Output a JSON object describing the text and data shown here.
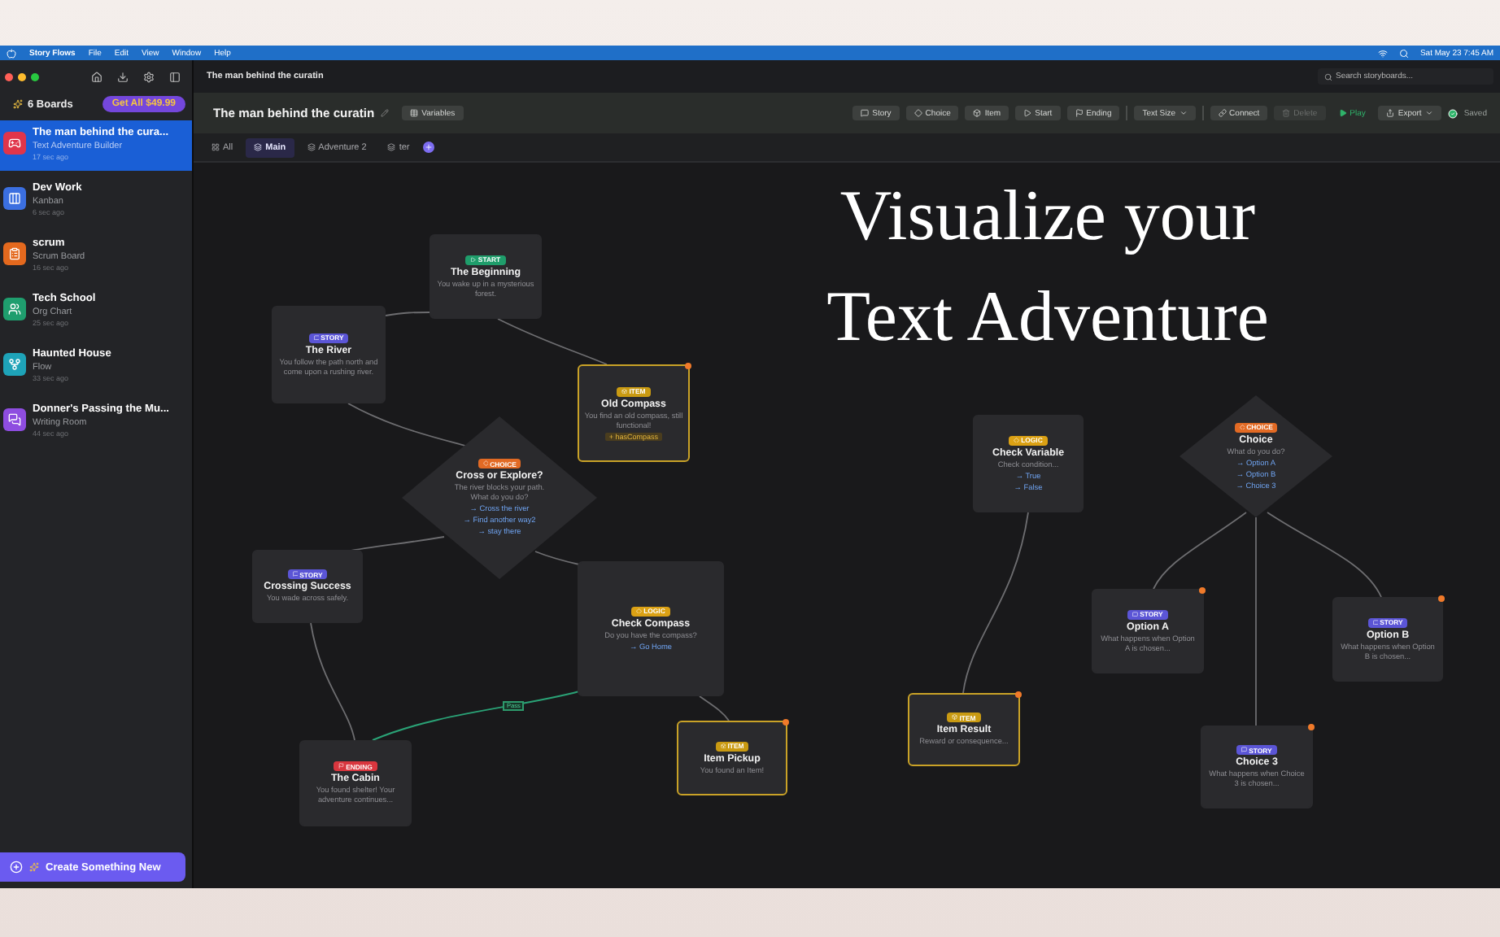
{
  "menu_bar": {
    "app": "Story Flows",
    "menus": [
      "File",
      "Edit",
      "View",
      "Window",
      "Help"
    ],
    "clock": "Sat May 23  7:45 AM"
  },
  "window": {
    "title": "The man behind the curatin"
  },
  "sidebar": {
    "boards_count": "6 Boards",
    "promo": "Get All $49.99",
    "items": [
      {
        "title": "The man behind the cura...",
        "subtitle": "Text Adventure Builder",
        "time": "17 sec ago",
        "color": "#e0354a",
        "kind": "game",
        "selected": true
      },
      {
        "title": "Dev Work",
        "subtitle": "Kanban",
        "time": "6 sec ago",
        "color": "#3b6fe0",
        "kind": "kanban",
        "selected": false
      },
      {
        "title": "scrum",
        "subtitle": "Scrum Board",
        "time": "16 sec ago",
        "color": "#e4691e",
        "kind": "scrum",
        "selected": false
      },
      {
        "title": "Tech School",
        "subtitle": "Org Chart",
        "time": "25 sec ago",
        "color": "#1f9e6e",
        "kind": "org",
        "selected": false
      },
      {
        "title": "Haunted House",
        "subtitle": "Flow",
        "time": "33 sec ago",
        "color": "#1ea3b8",
        "kind": "flow",
        "selected": false
      },
      {
        "title": "Donner's Passing the Mu...",
        "subtitle": "Writing Room",
        "time": "44 sec ago",
        "color": "#8e4de0",
        "kind": "writing",
        "selected": false
      }
    ],
    "create_button": "Create Something New"
  },
  "search": {
    "placeholder": "Search storyboards..."
  },
  "toolbar": {
    "title": "The man behind the curatin",
    "variables": "Variables",
    "buttons": [
      {
        "label": "Story",
        "kind": "story",
        "disabled": false
      },
      {
        "label": "Choice",
        "kind": "choice",
        "disabled": false
      },
      {
        "label": "Item",
        "kind": "item",
        "disabled": false
      },
      {
        "label": "Start",
        "kind": "start",
        "disabled": false
      },
      {
        "label": "Ending",
        "kind": "ending",
        "disabled": false
      },
      {
        "label": "Text Size",
        "kind": "textsize",
        "disabled": false
      },
      {
        "label": "Connect",
        "kind": "connect",
        "disabled": false
      },
      {
        "label": "Delete",
        "kind": "delete",
        "disabled": true
      }
    ],
    "play": "Play",
    "export": "Export",
    "status": "Saved"
  },
  "tabs": [
    {
      "label": "All",
      "selected": false
    },
    {
      "label": "Main",
      "selected": true
    },
    {
      "label": "Adventure 2",
      "selected": false
    },
    {
      "label": "ter",
      "selected": false
    }
  ],
  "headline": [
    "Visualize your",
    "Text Adventure"
  ],
  "nodes": [
    {
      "kind": "start",
      "badge": "START",
      "title": "The Beginning",
      "text": "You wake up in a mysterious forest.",
      "flagged": false
    },
    {
      "kind": "story",
      "badge": "STORY",
      "title": "The River",
      "text": "You follow the path north and come upon a rushing river.",
      "flagged": false
    },
    {
      "kind": "item",
      "badge": "ITEM",
      "title": "Old Compass",
      "text": "You find an old compass, still functional!",
      "tag": "+ hasCompass",
      "flagged": true
    },
    {
      "kind": "choice",
      "badge": "CHOICE",
      "title": "Cross or Explore?",
      "text": "The river blocks your path. What do you do?",
      "options": [
        "→ Cross the river",
        "→ Find another way2",
        "→ stay there"
      ],
      "flagged": false
    },
    {
      "kind": "story",
      "badge": "STORY",
      "title": "Crossing Success",
      "text": "You wade across safely.",
      "flagged": false
    },
    {
      "kind": "logic",
      "badge": "LOGIC",
      "title": "Check Compass",
      "text": "Do you have the compass?",
      "options": [
        "→ Go Home"
      ],
      "flagged": false
    },
    {
      "kind": "ending",
      "badge": "ENDING",
      "title": "The Cabin",
      "text": "You found shelter! Your adventure continues...",
      "flagged": false
    },
    {
      "kind": "item",
      "badge": "ITEM",
      "title": "Item Pickup",
      "text": "You found an Item!",
      "flagged": true
    },
    {
      "kind": "logic",
      "badge": "LOGIC",
      "title": "Check Variable",
      "text": "Check condition...",
      "options": [
        "→ True",
        "→ False"
      ],
      "flagged": false
    },
    {
      "kind": "choice",
      "badge": "CHOICE",
      "title": "Choice",
      "text": "What do you do?",
      "options": [
        "→ Option A",
        "→ Option B",
        "→ Choice 3"
      ],
      "flagged": false
    },
    {
      "kind": "story",
      "badge": "STORY",
      "title": "Option A",
      "text": "What happens when Option A is chosen...",
      "flagged": true
    },
    {
      "kind": "story",
      "badge": "STORY",
      "title": "Option B",
      "text": "What happens when Option B is chosen...",
      "flagged": true
    },
    {
      "kind": "item",
      "badge": "ITEM",
      "title": "Item Result",
      "text": "Reward or consequence...",
      "flagged": true
    },
    {
      "kind": "story",
      "badge": "STORY",
      "title": "Choice 3",
      "text": "What happens when Choice 3 is chosen...",
      "flagged": true
    }
  ],
  "edge_label": "Pass"
}
